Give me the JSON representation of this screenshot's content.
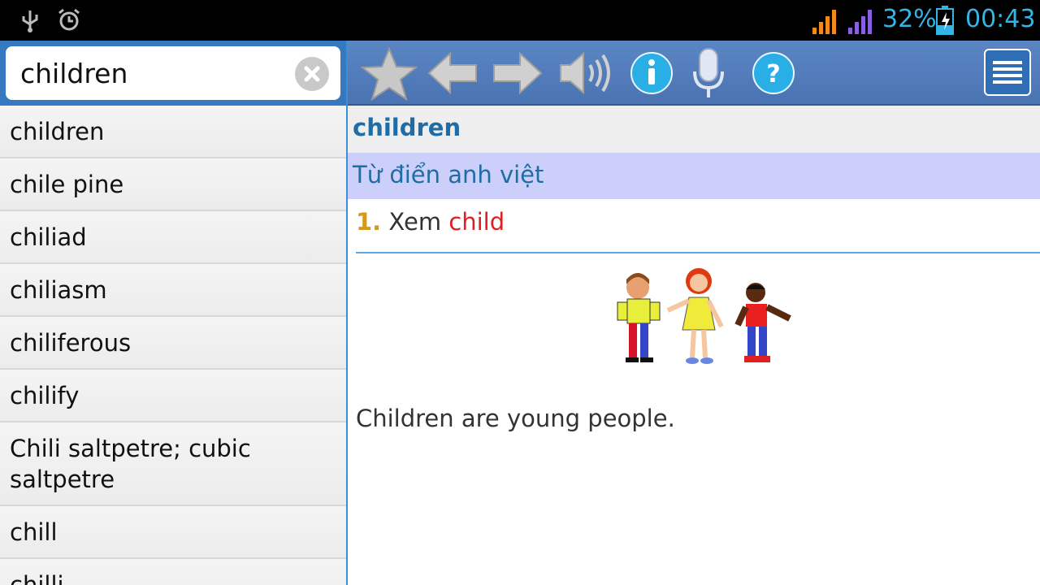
{
  "status_bar": {
    "battery": "32%",
    "time": "00:43",
    "icons": [
      "usb-icon",
      "alarm-icon",
      "signal-orange-icon",
      "signal-purple-icon",
      "battery-charging-icon"
    ]
  },
  "search": {
    "value": "children",
    "clear_icon": "clear-icon"
  },
  "word_list": [
    "children",
    "chile pine",
    "chiliad",
    "chiliasm",
    "chiliferous",
    "chilify",
    "Chili saltpetre; cubic saltpetre",
    "chill",
    "chilli"
  ],
  "toolbar": {
    "icons": [
      "star-icon",
      "back-arrow-icon",
      "forward-arrow-icon",
      "speaker-icon",
      "info-icon",
      "microphone-icon",
      "help-icon",
      "menu-icon"
    ]
  },
  "entry": {
    "headword": "children",
    "dictionary": "Từ điển anh việt",
    "definition_number": "1.",
    "definition_text": "Xem",
    "definition_link": "child",
    "example": "Children are young people."
  },
  "colors": {
    "accent": "#33b5e5",
    "toolbar": "#4a73b2",
    "headword": "#1f6da4",
    "dict_bar": "#cccff9",
    "link": "#e02020",
    "number": "#d49a1c"
  }
}
